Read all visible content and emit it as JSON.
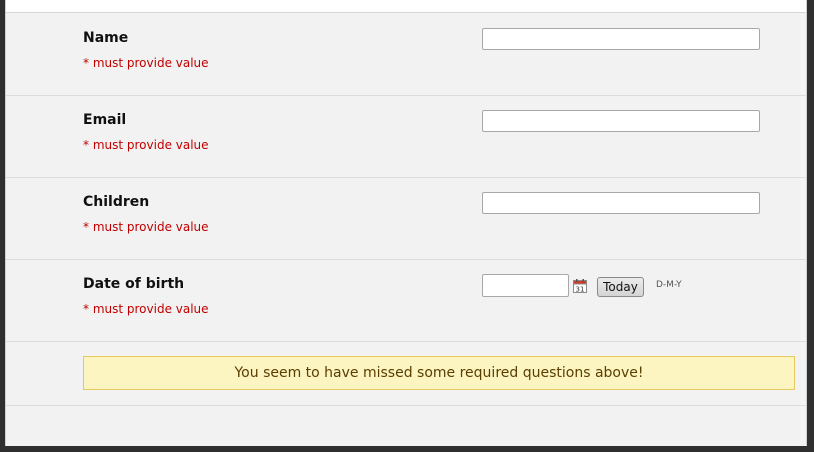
{
  "form": {
    "fields": [
      {
        "label": "Name",
        "required_note": "* must provide value",
        "value": ""
      },
      {
        "label": "Email",
        "required_note": "* must provide value",
        "value": ""
      },
      {
        "label": "Children",
        "required_note": "* must provide value",
        "value": ""
      },
      {
        "label": "Date of birth",
        "required_note": "* must provide value",
        "value": ""
      }
    ],
    "date": {
      "today_label": "Today",
      "format_hint": "D-M-Y",
      "calendar_icon": "calendar-icon",
      "calendar_icon_day": "31"
    },
    "warning": "You seem to have missed some required questions above!"
  },
  "colors": {
    "required": "#c00000",
    "warning_bg": "#fcf4c1",
    "warning_border": "#e8c95d",
    "panel_bg": "#f2f2f2"
  }
}
